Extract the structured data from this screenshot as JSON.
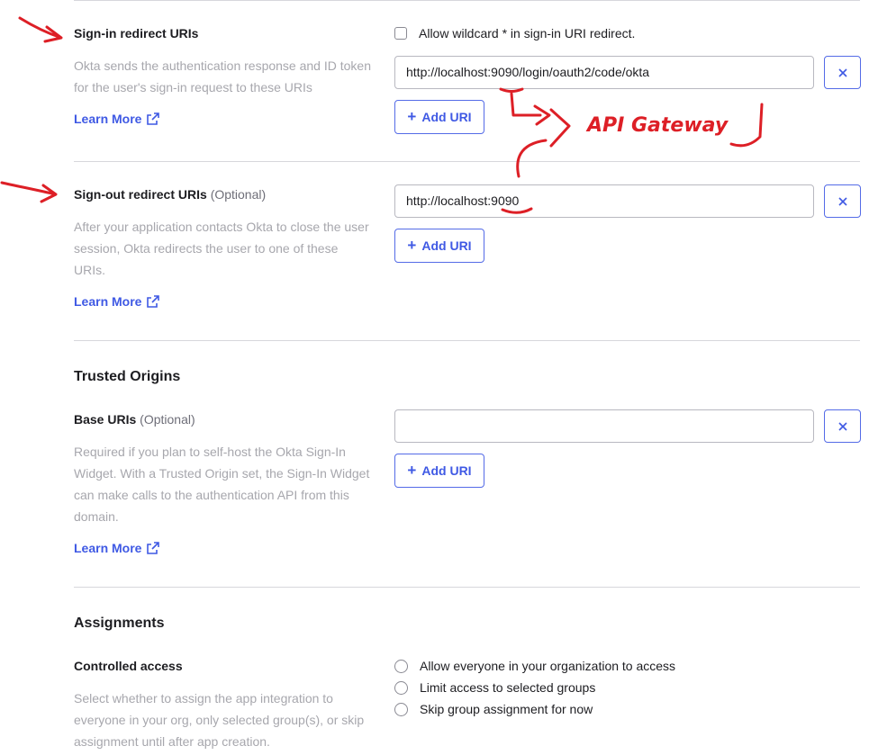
{
  "signin": {
    "label": "Sign-in redirect URIs",
    "wildcard_label": "Allow wildcard * in sign-in URI redirect.",
    "help": "Okta sends the authentication response and ID token for the user's sign-in request to these URIs",
    "learn_more": "Learn More",
    "uri_value": "http://localhost:9090/login/oauth2/code/okta",
    "add_uri": "Add URI"
  },
  "signout": {
    "label": "Sign-out redirect URIs",
    "optional": "(Optional)",
    "help": "After your application contacts Okta to close the user session, Okta redirects the user to one of these URIs.",
    "learn_more": "Learn More",
    "uri_value": "http://localhost:9090",
    "add_uri": "Add URI"
  },
  "trusted_origins": {
    "title": "Trusted Origins",
    "base_label": "Base URIs",
    "optional": "(Optional)",
    "help": "Required if you plan to self-host the Okta Sign-In Widget. With a Trusted Origin set, the Sign-In Widget can make calls to the authentication API from this domain.",
    "learn_more": "Learn More",
    "uri_value": "",
    "add_uri": "Add URI"
  },
  "assignments": {
    "title": "Assignments",
    "controlled_label": "Controlled access",
    "help": "Select whether to assign the app integration to everyone in your org, only selected group(s), or skip assignment until after app creation.",
    "options": [
      "Allow everyone in your organization to access",
      "Limit access to selected groups",
      "Skip group assignment for now"
    ]
  },
  "annotation": {
    "text": "API Gateway",
    "color": "#dd1f26"
  },
  "colors": {
    "accent": "#3f59e4",
    "muted_text": "#a7a7ad",
    "divider": "#d7d7dc"
  }
}
